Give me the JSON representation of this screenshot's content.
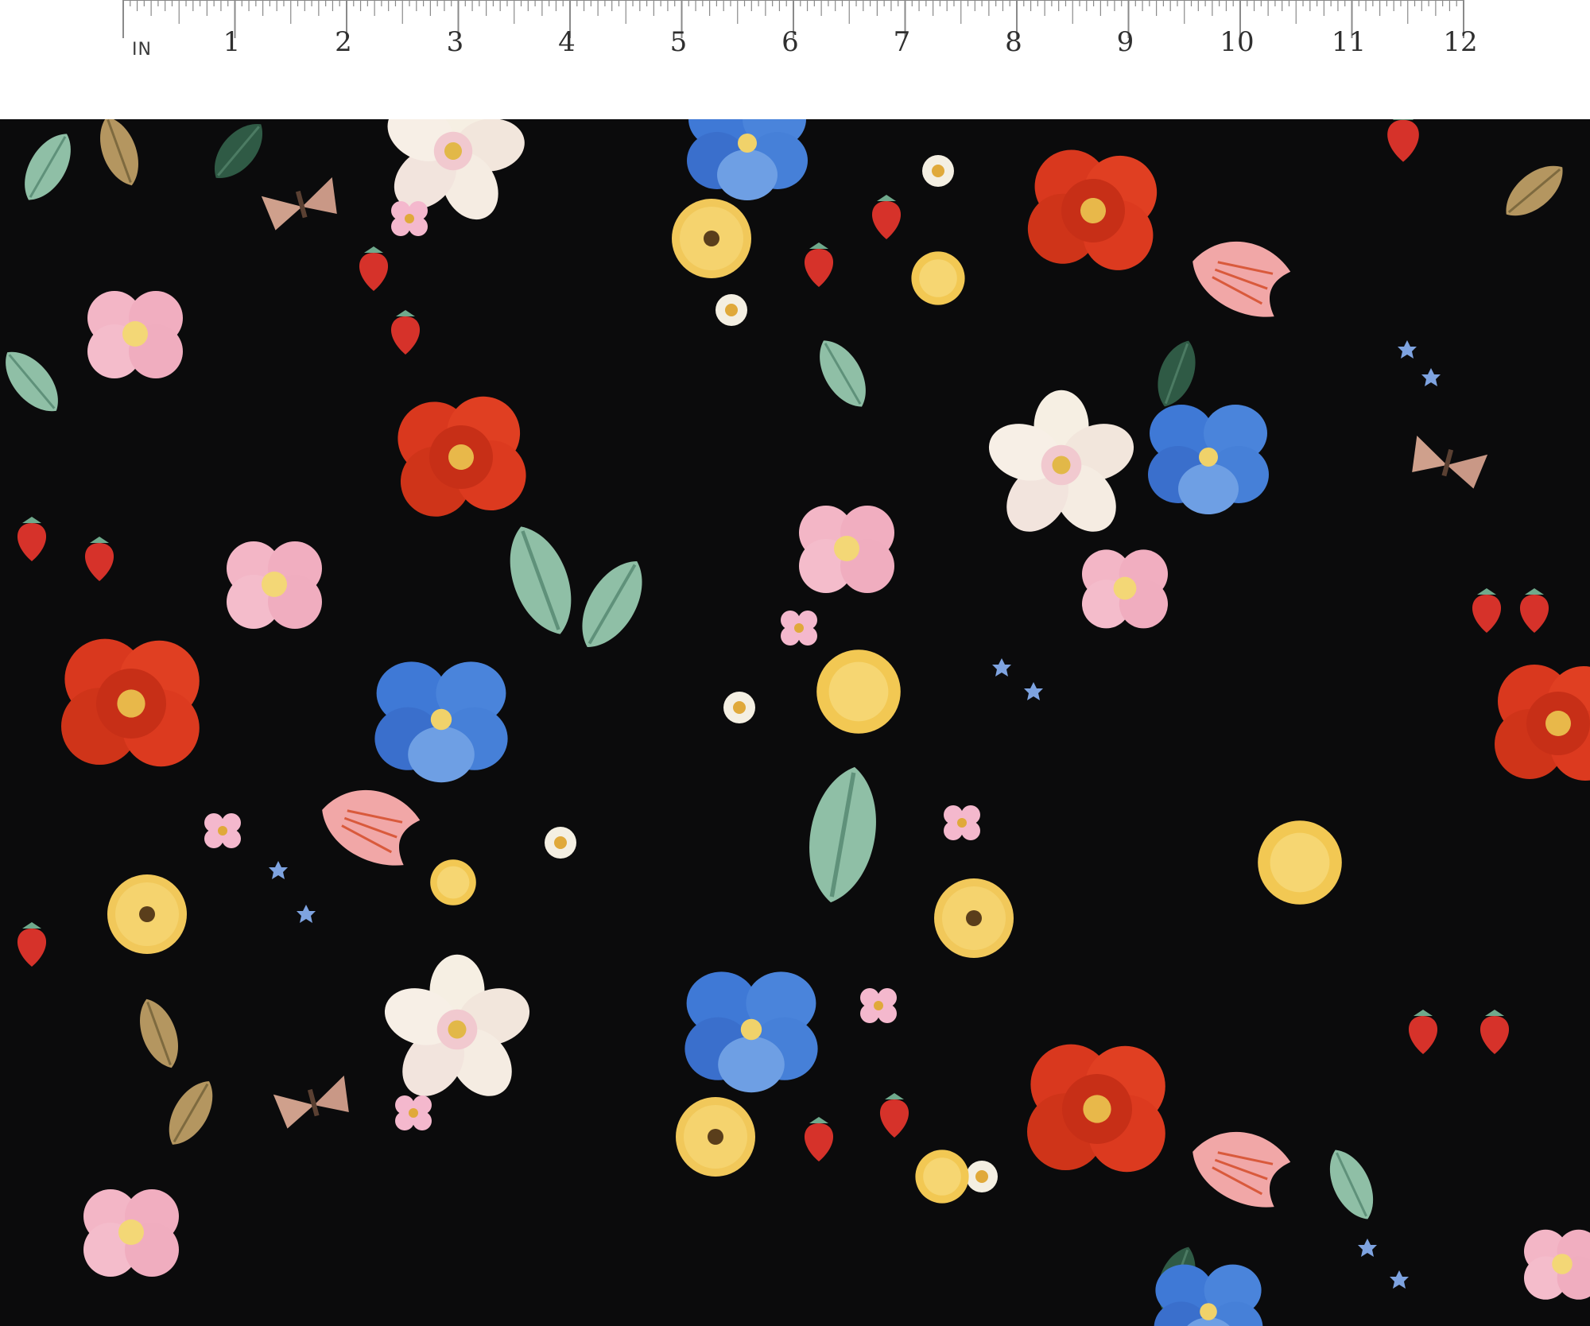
{
  "ruler": {
    "unit_label": "IN",
    "numbers": [
      "1",
      "2",
      "3",
      "4",
      "5",
      "6",
      "7",
      "8",
      "9",
      "10",
      "11",
      "12"
    ]
  },
  "fabric": {
    "background_color": "#0b0b0c",
    "motifs": [
      "red-poppy-icon",
      "white-cosmos-icon",
      "blue-pansy-icon",
      "pink-tulip-icon",
      "yellow-daisy-icon",
      "strawberry-icon",
      "moth-icon",
      "leaf-icon"
    ]
  }
}
